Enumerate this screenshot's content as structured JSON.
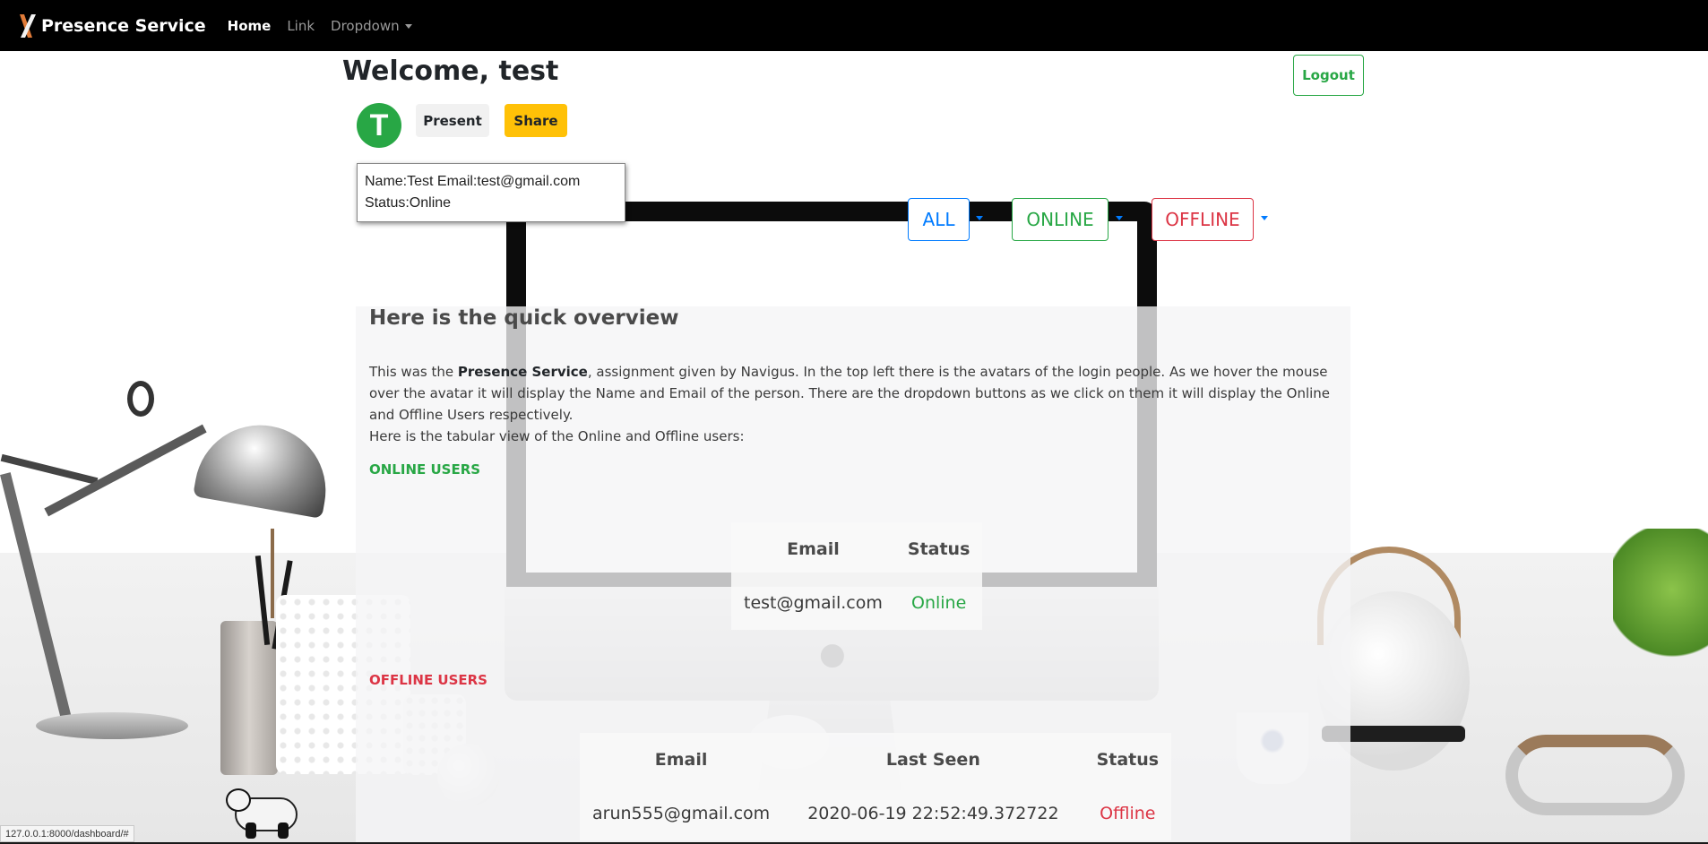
{
  "navbar": {
    "brand": "Presence Service",
    "links": [
      {
        "label": "Home",
        "active": true
      },
      {
        "label": "Link",
        "active": false
      },
      {
        "label": "Dropdown",
        "active": false
      }
    ]
  },
  "header": {
    "welcome": "Welcome, test",
    "logout_label": "Logout"
  },
  "avatar": {
    "initial": "T",
    "color": "#28a745"
  },
  "actions": {
    "present_label": "Present",
    "share_label": "Share"
  },
  "tooltip": {
    "line1": "Name:Test Email:test@gmail.com",
    "line2": "Status:Online"
  },
  "filters": {
    "all_label": "ALL",
    "online_label": "ONLINE",
    "offline_label": "OFFLINE"
  },
  "overview": {
    "title": "Here is the quick overview",
    "para_prefix": "This was the ",
    "para_bold": "Presence Service",
    "para_rest": ", assignment given by Navigus. In the top left there is the avatars of the login people. As we hover the mouse over the avatar it will display the Name and Email of the person. There are the dropdown buttons as we click on them it will display the Online and Offline Users respectively.",
    "para_line2": "Here is the tabular view of the Online and Offline users:"
  },
  "online_users": {
    "title": "ONLINE USERS",
    "headers": [
      "Email",
      "Status"
    ],
    "rows": [
      [
        "test@gmail.com",
        "Online"
      ]
    ]
  },
  "offline_users": {
    "title": "OFFLINE USERS",
    "headers": [
      "Email",
      "Last Seen",
      "Status"
    ],
    "rows": [
      [
        "arun555@gmail.com",
        "2020-06-19 22:52:49.372722",
        "Offline"
      ]
    ]
  },
  "statusbar": {
    "url": "127.0.0.1:8000/dashboard/#"
  },
  "colors": {
    "primary": "#007bff",
    "success": "#28a745",
    "danger": "#dc3545",
    "warning": "#ffc107",
    "navbar": "#000000"
  }
}
